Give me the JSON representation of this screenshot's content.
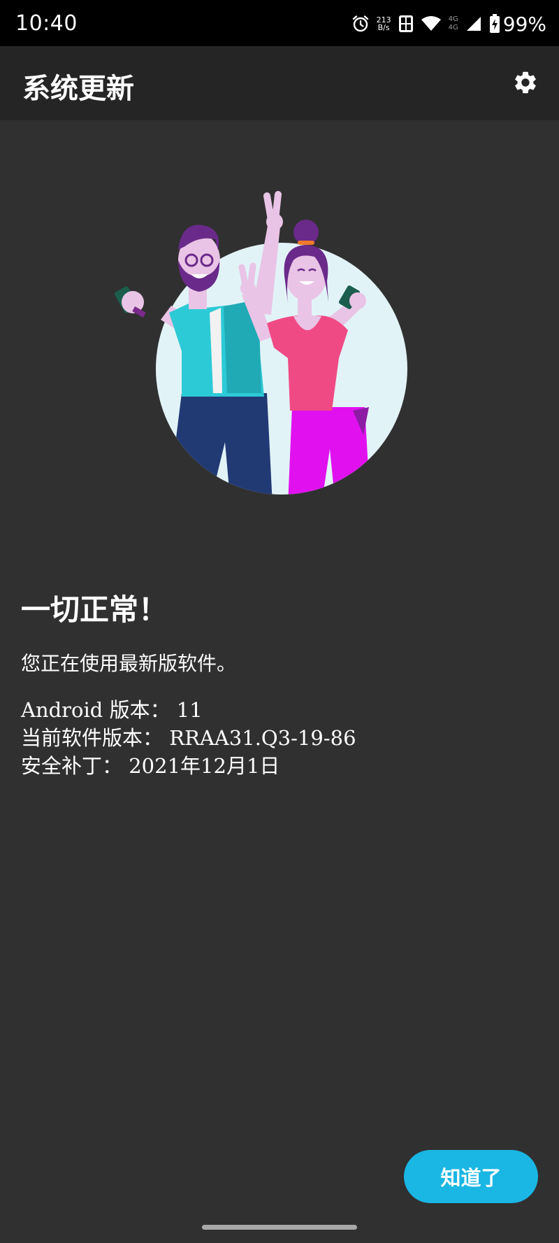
{
  "status_bar": {
    "time": "10:40",
    "net_speed_value": "213",
    "net_speed_unit": "B/s",
    "network_top": "4G",
    "network_bottom": "4G",
    "battery": "99%",
    "icons": [
      "alarm-icon",
      "sim-hd-icon",
      "wifi-icon",
      "signal-icon",
      "battery-charging-icon"
    ]
  },
  "app_bar": {
    "title": "系统更新",
    "settings_icon": "gear-icon"
  },
  "main": {
    "headline": "一切正常！",
    "subline": "您正在使用最新版软件。",
    "info": [
      {
        "label": "Android 版本：",
        "value": "11"
      },
      {
        "label": "当前软件版本：",
        "value": "RRAA31.Q3-19-86"
      },
      {
        "label": "安全补丁：",
        "value": "2021年12月1日"
      }
    ]
  },
  "actions": {
    "ok_label": "知道了"
  },
  "colors": {
    "background": "#303030",
    "app_bar": "#252525",
    "status_bar": "#000000",
    "accent": "#1ab6e4"
  }
}
